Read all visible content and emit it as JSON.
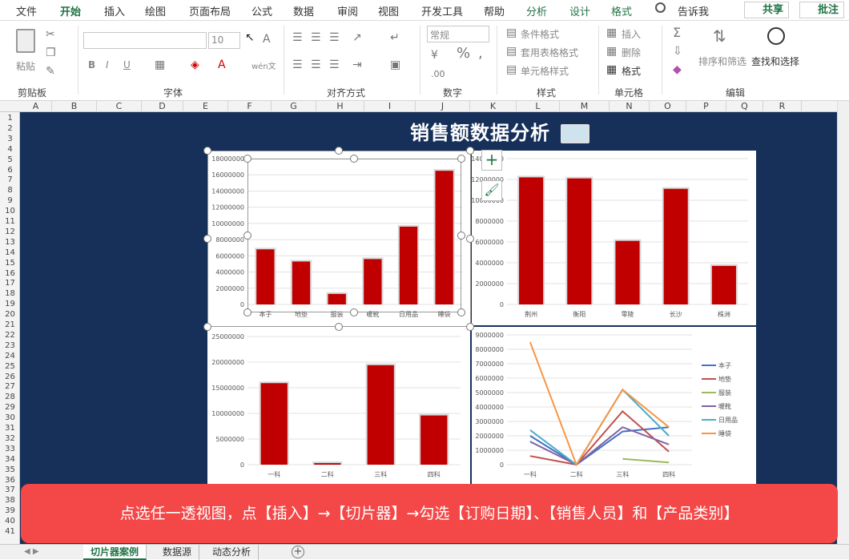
{
  "ribbon_tabs": [
    "文件",
    "开始",
    "插入",
    "绘图",
    "页面布局",
    "公式",
    "数据",
    "审阅",
    "视图",
    "开发工具",
    "帮助",
    "分析",
    "设计",
    "格式"
  ],
  "active_tab": "开始",
  "tell_me": "告诉我",
  "share": "共享",
  "comment": "批注",
  "groups": {
    "clipboard": "剪贴板",
    "font": "字体",
    "align": "对齐方式",
    "number": "数字",
    "styles": "样式",
    "cells": "单元格",
    "edit": "编辑"
  },
  "clipboard": {
    "paste": "粘贴"
  },
  "font": {
    "size": "10",
    "bold": "B",
    "italic": "I",
    "underline": "U",
    "wen": "wén文"
  },
  "number": {
    "format": "常规"
  },
  "styles": {
    "cond": "条件格式",
    "table": "套用表格格式",
    "cell": "单元格样式"
  },
  "cells": {
    "insert": "插入",
    "delete": "删除",
    "format": "格式"
  },
  "edit": {
    "sort": "排序和筛选",
    "find": "查找和选择"
  },
  "columns": [
    "A",
    "B",
    "C",
    "D",
    "E",
    "F",
    "G",
    "H",
    "I",
    "J",
    "K",
    "L",
    "M",
    "N",
    "O",
    "P",
    "Q",
    "R"
  ],
  "rows": [
    "1",
    "2",
    "3",
    "4",
    "5",
    "6",
    "7",
    "8",
    "9",
    "10",
    "11",
    "12",
    "13",
    "14",
    "15",
    "16",
    "17",
    "18",
    "19",
    "20",
    "21",
    "22",
    "23",
    "24",
    "25",
    "26",
    "27",
    "28",
    "29",
    "30",
    "31",
    "32",
    "33",
    "34",
    "35",
    "36",
    "37",
    "38",
    "39",
    "40",
    "41"
  ],
  "dashboard_title": "销售额数据分析",
  "banner": "点选任一透视图，点【插入】→【切片器】→勾选【订购日期】、【销售人员】和【产品类别】",
  "sheet_tabs": [
    "切片器案例",
    "数据源",
    "动态分析"
  ],
  "active_sheet": "切片器案例",
  "accent": "#217346",
  "bar_color": "#c00000",
  "chart_data": [
    {
      "type": "bar",
      "categories": [
        "本子",
        "地垫",
        "服装",
        "暖靴",
        "日用品",
        "睡袋"
      ],
      "values": [
        6800000,
        5300000,
        1300000,
        5600000,
        9600000,
        16500000
      ],
      "ylim": [
        0,
        18000000
      ],
      "yticks": [
        0,
        2000000,
        4000000,
        6000000,
        8000000,
        10000000,
        12000000,
        14000000,
        16000000,
        18000000
      ],
      "title": "",
      "xlabel": "",
      "ylabel": ""
    },
    {
      "type": "bar",
      "categories": [
        "荆州",
        "衡阳",
        "零陵",
        "长沙",
        "株洲"
      ],
      "values": [
        12200000,
        12100000,
        6100000,
        11100000,
        3700000
      ],
      "ylim": [
        0,
        14000000
      ],
      "yticks": [
        0,
        2000000,
        4000000,
        6000000,
        8000000,
        10000000,
        12000000,
        14000000
      ],
      "title": "",
      "xlabel": "",
      "ylabel": ""
    },
    {
      "type": "bar",
      "categories": [
        "一科",
        "二科",
        "三科",
        "四科"
      ],
      "values": [
        15900000,
        300000,
        19400000,
        9600000
      ],
      "ylim": [
        0,
        25000000
      ],
      "yticks": [
        0,
        5000000,
        10000000,
        15000000,
        20000000,
        25000000
      ],
      "title": "",
      "xlabel": "",
      "ylabel": ""
    },
    {
      "type": "line",
      "categories": [
        "一科",
        "二科",
        "三科",
        "四科"
      ],
      "ylim": [
        0,
        9000000
      ],
      "yticks": [
        0,
        1000000,
        2000000,
        3000000,
        4000000,
        5000000,
        6000000,
        7000000,
        8000000,
        9000000
      ],
      "legend": "right",
      "series": [
        {
          "name": "本子",
          "color": "#4472c4",
          "values": [
            2000000,
            0,
            2300000,
            2600000
          ]
        },
        {
          "name": "地垫",
          "color": "#c0504d",
          "values": [
            600000,
            0,
            3700000,
            900000
          ]
        },
        {
          "name": "服装",
          "color": "#9bbb59",
          "values": [
            null,
            null,
            400000,
            150000
          ]
        },
        {
          "name": "暖靴",
          "color": "#8064a2",
          "values": [
            1600000,
            0,
            2600000,
            1400000
          ]
        },
        {
          "name": "日用品",
          "color": "#4bacc6",
          "values": [
            2400000,
            0,
            5200000,
            2000000
          ]
        },
        {
          "name": "睡袋",
          "color": "#f79646",
          "values": [
            8500000,
            0,
            5200000,
            2600000
          ]
        }
      ]
    }
  ]
}
